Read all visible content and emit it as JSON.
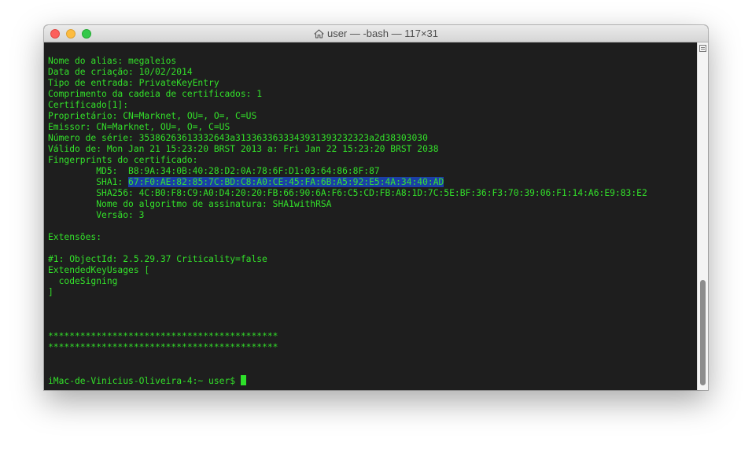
{
  "window": {
    "title": "user — -bash — 117×31"
  },
  "terminal": {
    "lines": [
      "Nome do alias: megaleios",
      "Data de criação: 10/02/2014",
      "Tipo de entrada: PrivateKeyEntry",
      "Comprimento da cadeia de certificados: 1",
      "Certificado[1]:",
      "Proprietário: CN=Marknet, OU=, O=, C=US",
      "Emissor: CN=Marknet, OU=, O=, C=US",
      "Número de série: 35386263613332643a313363363334393139323 23a2d38303030",
      "Válido de: Mon Jan 21 15:23:20 BRST 2013 a: Fri Jan 22 15:23:20 BRST 2038",
      "Fingerprints do certificado:",
      "         MD5:  B8:9A:34:0B:40:28:D2:0A:78:6F:D1:03:64:86:8F:87",
      "         SHA256: 4C:B0:F8:C9:A0:D4:20:20:FB:66:90:6A:F6:C5:CD:FB:A8:1D:7C:5E:BF:36:F3:70:39:06:F1:14:A6:E9:83:E2",
      "         Nome do algoritmo de assinatura: SHA1withRSA",
      "         Versão: 3",
      "",
      "Extensões:",
      "",
      "#1: ObjectId: 2.5.29.37 Criticality=false",
      "ExtendedKeyUsages [",
      "  codeSigning",
      "]",
      "",
      "",
      "",
      "*******************************************",
      "*******************************************",
      "",
      ""
    ],
    "serial_line": "Número de série: 35386263613332643a3133633633343931393232323a2d38303030",
    "sha1_prefix": "         SHA1: ",
    "sha1_value": "67:F0:AE:82:85:7C:BD:C8:A0:CE:45:FA:6B:A5:92:E5:4A:34:40:AD",
    "prompt": "iMac-de-Vinicius-Oliveira-4:~ user$ "
  },
  "colors": {
    "terminal_background": "#1e1e1e",
    "text": "#33e02a",
    "selection": "#1b3fa6"
  },
  "icons": {
    "title_icon": "home-icon",
    "scroll_button": "split-pane-icon"
  }
}
